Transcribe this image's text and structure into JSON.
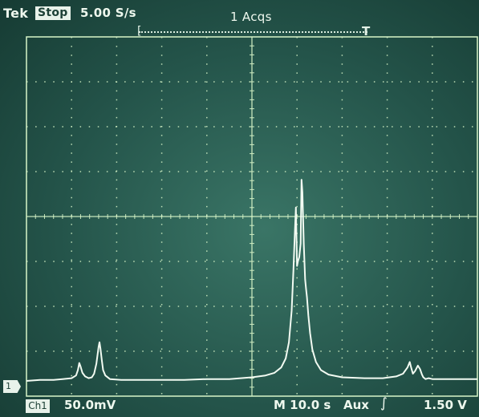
{
  "header": {
    "brand": "Tek",
    "state": "Stop",
    "timebase": "5.00 S/s",
    "acquisitions": "1 Acqs"
  },
  "trigger_bar": {
    "start_glyph": "[",
    "trigger_glyph": "T"
  },
  "channel_marker": "1",
  "footer": {
    "channel_label": "Ch1",
    "channel_scale": "50.0mV",
    "timescale": "M 10.0 s",
    "trigger_source": "Aux",
    "trigger_slope_glyph": "∫",
    "trigger_level": "1.50 V"
  },
  "colors": {
    "screen": "#2f6558",
    "grid": "#d8f5c8",
    "trace": "#f2fbf2",
    "text": "#eef8ee"
  },
  "chart_data": {
    "type": "line",
    "x_unit": "s",
    "y_unit": "V",
    "xlim": [
      -50,
      50
    ],
    "ylim": [
      -0.2,
      0.2
    ],
    "x": [
      -50,
      -47,
      -44,
      -42,
      -40,
      -39,
      -38.6,
      -38.3,
      -38,
      -37.6,
      -37,
      -36.2,
      -35.5,
      -35,
      -34.5,
      -34,
      -33.8,
      -33.6,
      -33.3,
      -33,
      -32.5,
      -31.5,
      -29,
      -25,
      -20,
      -15,
      -10,
      -5,
      0,
      3,
      5,
      6.5,
      7.5,
      8.2,
      8.8,
      9.2,
      9.5,
      9.75,
      10,
      10.2,
      10.5,
      10.8,
      11,
      11.2,
      11.5,
      11.8,
      12,
      12.2,
      12.5,
      12.9,
      13.4,
      14.2,
      15.3,
      17,
      20,
      25,
      29,
      32,
      33.5,
      34.5,
      35,
      35.3,
      35.7,
      36.2,
      36.8,
      37.3,
      37.7,
      38,
      38.5,
      39.2,
      40,
      42,
      46,
      50
    ],
    "y": [
      -0.183,
      -0.182,
      -0.182,
      -0.181,
      -0.18,
      -0.177,
      -0.171,
      -0.163,
      -0.167,
      -0.174,
      -0.178,
      -0.18,
      -0.179,
      -0.175,
      -0.164,
      -0.145,
      -0.14,
      -0.147,
      -0.16,
      -0.171,
      -0.177,
      -0.181,
      -0.182,
      -0.182,
      -0.182,
      -0.182,
      -0.181,
      -0.181,
      -0.179,
      -0.177,
      -0.174,
      -0.168,
      -0.158,
      -0.14,
      -0.105,
      -0.06,
      -0.02,
      0.01,
      -0.055,
      -0.05,
      -0.045,
      -0.03,
      0.041,
      0.027,
      -0.03,
      -0.07,
      -0.08,
      -0.09,
      -0.11,
      -0.13,
      -0.148,
      -0.162,
      -0.171,
      -0.176,
      -0.179,
      -0.18,
      -0.18,
      -0.178,
      -0.175,
      -0.168,
      -0.162,
      -0.168,
      -0.175,
      -0.172,
      -0.166,
      -0.17,
      -0.176,
      -0.179,
      -0.181,
      -0.18,
      -0.181,
      -0.181,
      -0.181,
      -0.181
    ],
    "grid": true,
    "divisions": {
      "x": 10,
      "y": 8
    }
  }
}
